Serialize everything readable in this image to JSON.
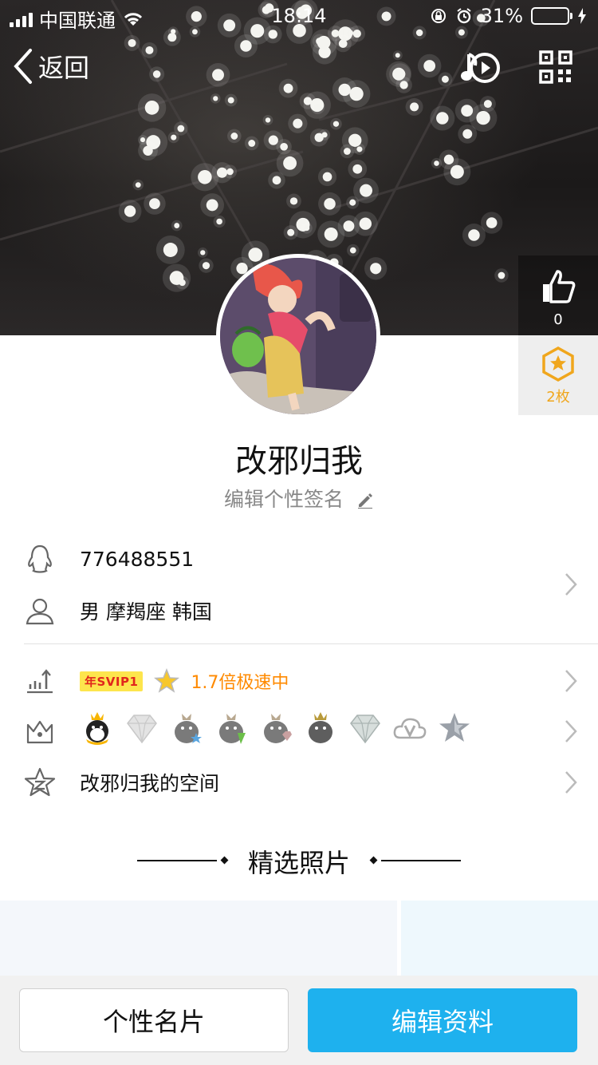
{
  "status_bar": {
    "carrier": "中国联通",
    "time": "18:14",
    "battery_percent": "31%",
    "battery_level": 0.31,
    "icons": [
      "signal-icon",
      "wifi-icon",
      "orientation-lock-icon",
      "alarm-icon",
      "battery-icon",
      "charging-icon"
    ]
  },
  "nav": {
    "back_label": "返回",
    "music_icon": "music-play-icon",
    "qr_icon": "qr-code-icon"
  },
  "like": {
    "count": "0",
    "icon": "thumbs-up-icon"
  },
  "badge": {
    "label": "2枚",
    "icon": "star-hexagon-icon"
  },
  "profile": {
    "nickname": "改邪归我",
    "signature_placeholder": "编辑个性签名"
  },
  "info": {
    "qq_number": "776488551",
    "gender_info": "男 摩羯座 韩国"
  },
  "vip": {
    "tag": "年SVIP1",
    "speed_text": "1.7倍极速中"
  },
  "badges_row": {
    "icons": [
      "crown-penguin-icon",
      "diamond-icon",
      "gray-penguin-star-icon",
      "gray-penguin-lightning-icon",
      "gray-penguin-diamond-icon",
      "gray-penguin-crown-icon",
      "gray-diamond-icon",
      "gray-cloud-v-icon",
      "gray-star-icon"
    ]
  },
  "space": {
    "label": "改邪归我的空间"
  },
  "section": {
    "title": "精选照片"
  },
  "buttons": {
    "card_label": "个性名片",
    "edit_label": "编辑资料"
  },
  "colors": {
    "accent_blue": "#1eb1ee",
    "orange": "#ff8a00",
    "badge_gold": "#f0a61c",
    "svip_yellow": "#fde54d",
    "svip_red": "#e1261c"
  }
}
